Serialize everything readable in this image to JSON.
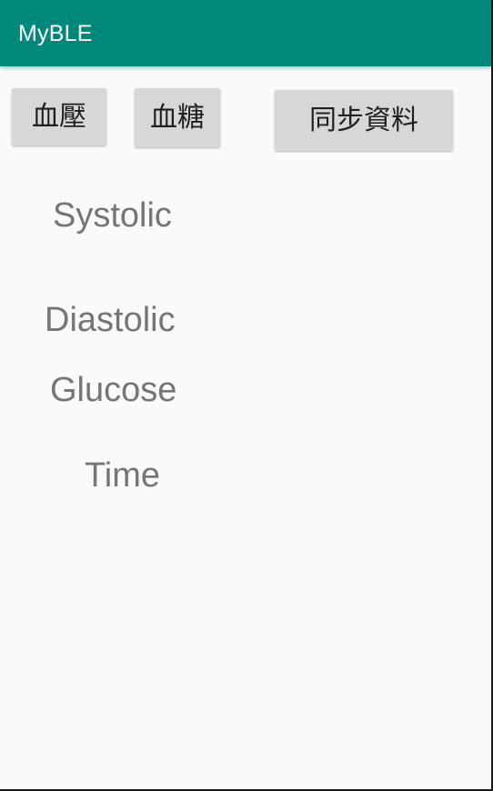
{
  "app_bar": {
    "title": "MyBLE",
    "color": "#00897b"
  },
  "buttons": {
    "blood_pressure": "血壓",
    "blood_glucose": "血糖",
    "sync_data": "同步資料"
  },
  "readings": {
    "systolic_label": "Systolic",
    "diastolic_label": "Diastolic",
    "glucose_label": "Glucose",
    "time_label": "Time"
  }
}
